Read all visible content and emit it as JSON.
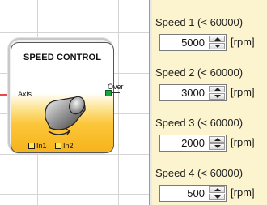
{
  "block": {
    "title": "SPEED CONTROL",
    "input_axis": "Axis",
    "output_over": "Over",
    "input_in1": "In1",
    "input_in2": "In2",
    "icon": "rotating-cylinder-icon"
  },
  "params": [
    {
      "label": "Speed 1 (< 60000)",
      "value": "5000",
      "unit": "[rpm]"
    },
    {
      "label": "Speed 2 (< 60000)",
      "value": "3000",
      "unit": "[rpm]"
    },
    {
      "label": "Speed 3 (< 60000)",
      "value": "2000",
      "unit": "[rpm]"
    },
    {
      "label": "Speed 4 (< 60000)",
      "value": "500",
      "unit": "[rpm]"
    }
  ],
  "colors": {
    "panel_background": "#fcf4cf",
    "block_gradient": "#f6b21a",
    "input_arrow": "#e01e1e",
    "output_pin": "#15a838",
    "input_pin": "#ffe55a"
  }
}
